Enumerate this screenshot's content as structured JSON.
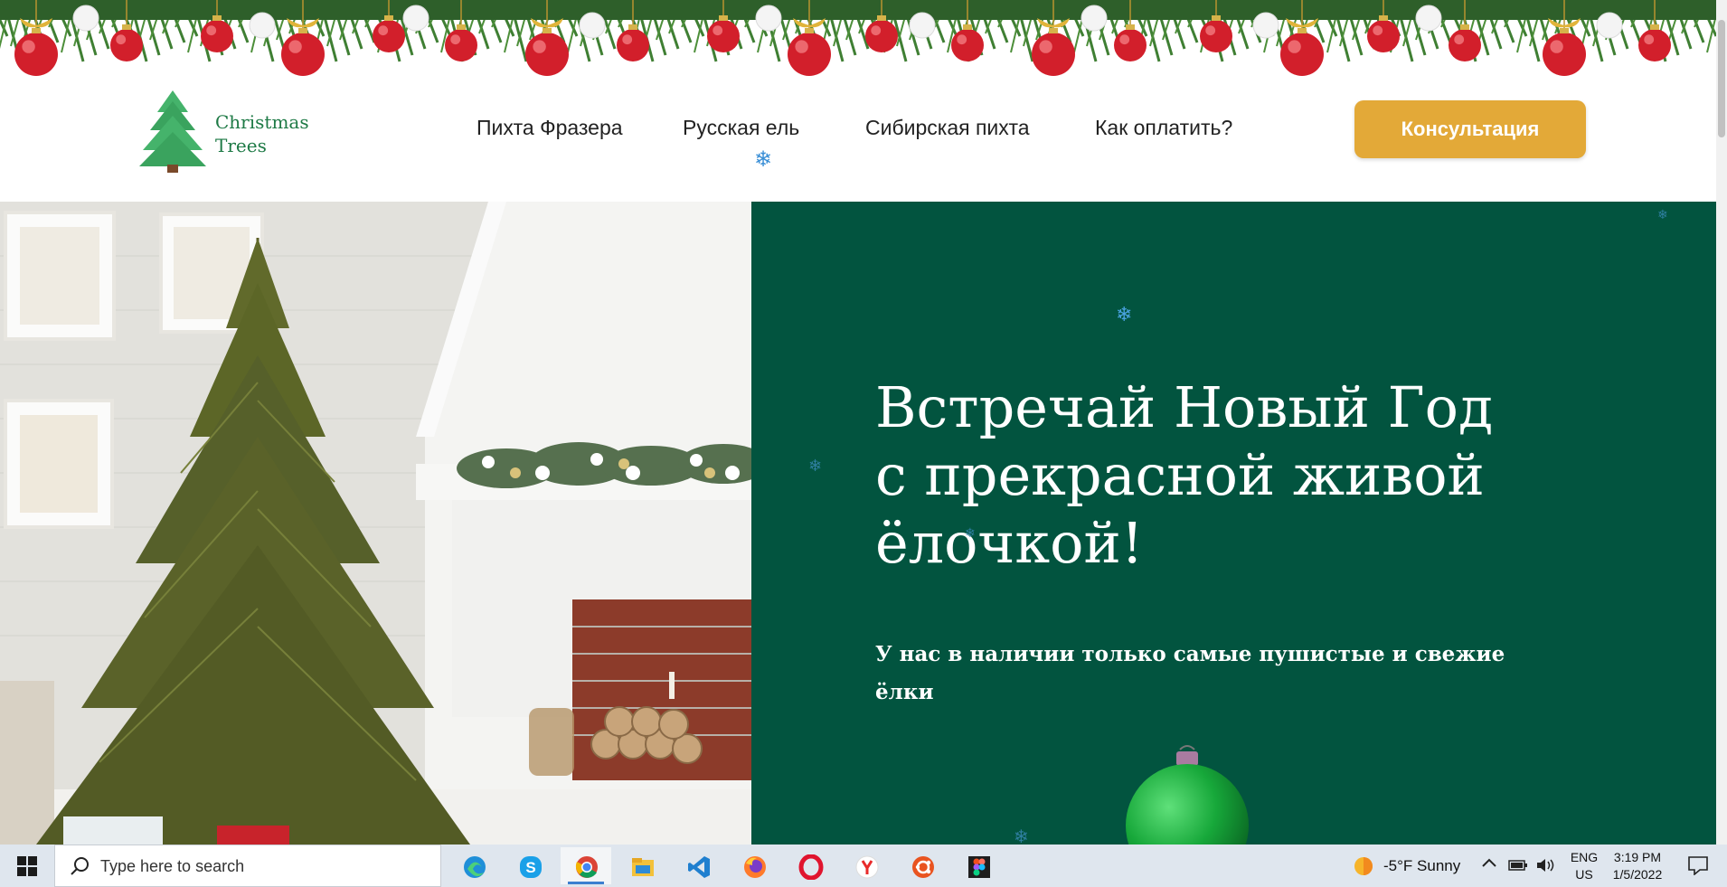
{
  "logo": {
    "line1": "Christmas",
    "line2": "Trees"
  },
  "nav": {
    "items": [
      {
        "label": "Пихта Фразера"
      },
      {
        "label": "Русская ель"
      },
      {
        "label": "Сибирская пихта"
      },
      {
        "label": "Как оплатить?"
      }
    ],
    "cta_label": "Консультация"
  },
  "hero": {
    "title_lines": [
      "Встречай Новый Год",
      "с прекрасной живой",
      "ёлочкой!"
    ],
    "subtitle_lines": [
      "У нас в наличии только самые пушистые и свежие",
      "ёлки"
    ]
  },
  "taskbar": {
    "search_placeholder": "Type here to search",
    "apps": [
      "edge-icon",
      "skype-icon",
      "chrome-icon",
      "file-explorer-icon",
      "vscode-icon",
      "firefox-icon",
      "opera-icon",
      "yandex-icon",
      "ubuntu-icon",
      "figma-icon"
    ],
    "weather": "-5°F  Sunny",
    "lang_line1": "ENG",
    "lang_line2": "US",
    "time": "3:19 PM",
    "date": "1/5/2022"
  },
  "colors": {
    "hero_green": "#02543f",
    "cta_gold": "#e3a938",
    "logo_green": "#1e7a46"
  }
}
